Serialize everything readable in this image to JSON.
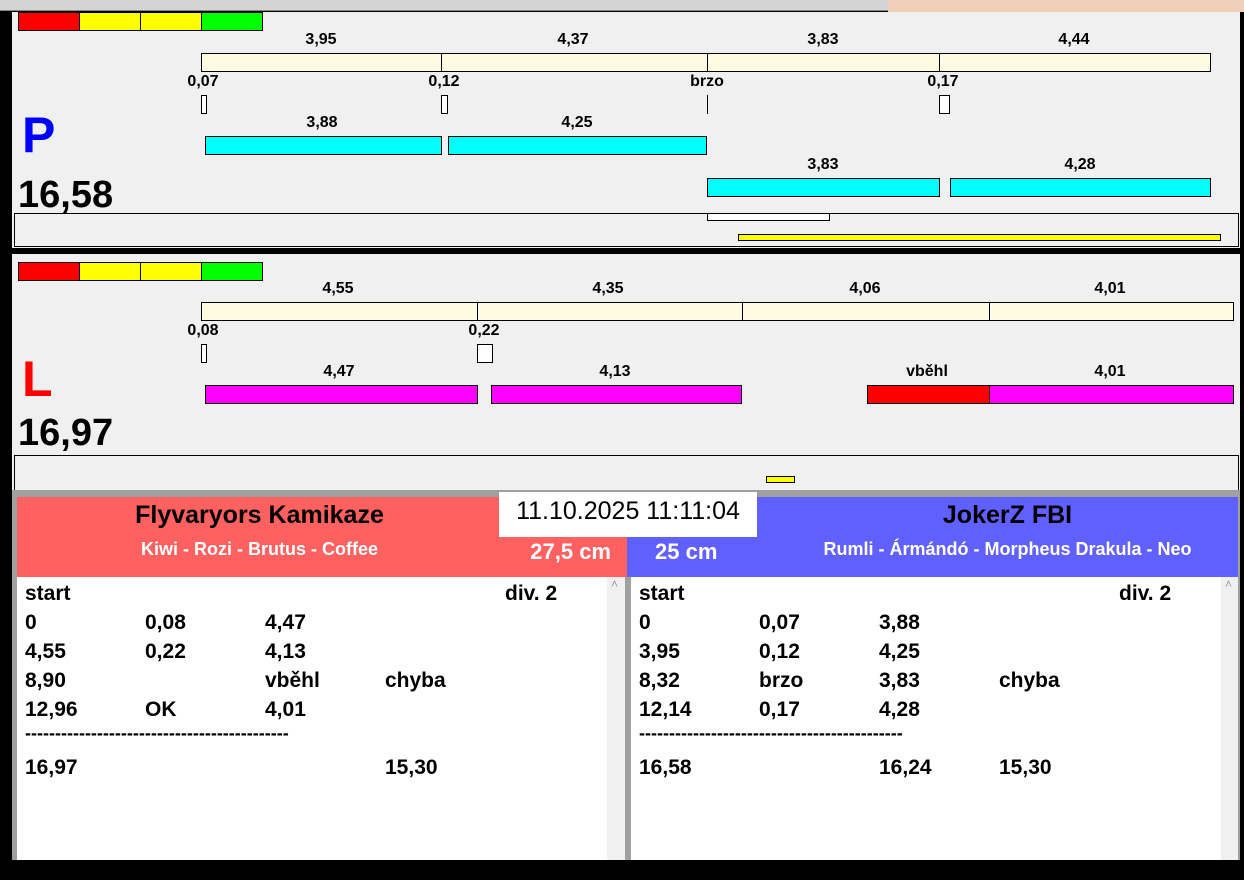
{
  "right_lane": {
    "letter": "P",
    "total": "16,58",
    "splits": [
      "3,95",
      "4,37",
      "3,83",
      "4,44"
    ],
    "reactions": [
      "0,07",
      "0,12",
      "brzo",
      "0,17"
    ],
    "dog_times_row1": [
      "3,88",
      "4,25"
    ],
    "dog_times_row2": [
      "3,83",
      "4,28"
    ]
  },
  "left_lane": {
    "letter": "L",
    "total": "16,97",
    "splits": [
      "4,55",
      "4,35",
      "4,06",
      "4,01"
    ],
    "reactions": [
      "0,08",
      "0,22"
    ],
    "dog_times_row1": [
      "4,47",
      "4,13"
    ],
    "fault_label": "vběhl",
    "dog_times_row2": [
      "4,01"
    ]
  },
  "timestamp": "11.10.2025 11:11:04",
  "team_left": {
    "name": "Flyvaryors Kamikaze",
    "dogs": "Kiwi - Rozi - Brutus - Coffee",
    "height": "27,5 cm",
    "color": "#ff6060"
  },
  "team_right": {
    "name": "JokerZ FBI",
    "dogs": "Rumli - Ármándó - Morpheus Drakula - Neo",
    "height": "25 cm",
    "color": "#6060ff"
  },
  "list_left": {
    "header": [
      "start",
      "div.  2"
    ],
    "rows": [
      [
        "0",
        "0,08",
        "4,47",
        ""
      ],
      [
        "4,55",
        "0,22",
        "4,13",
        ""
      ],
      [
        "8,90",
        "",
        "vběhl",
        "chyba"
      ],
      [
        "12,96",
        "OK",
        "4,01",
        ""
      ]
    ],
    "separator": "--------------------------------------------",
    "totals": [
      "16,97",
      "",
      "15,30"
    ]
  },
  "list_right": {
    "header": [
      "start",
      "div.  2"
    ],
    "rows": [
      [
        "0",
        "0,07",
        "3,88",
        ""
      ],
      [
        "3,95",
        "0,12",
        "4,25",
        ""
      ],
      [
        "8,32",
        "brzo",
        "3,83",
        "chyba"
      ],
      [
        "12,14",
        "0,17",
        "4,28",
        ""
      ]
    ],
    "separator": "--------------------------------------------",
    "totals": [
      "16,58",
      "16,24",
      "15,30"
    ]
  }
}
